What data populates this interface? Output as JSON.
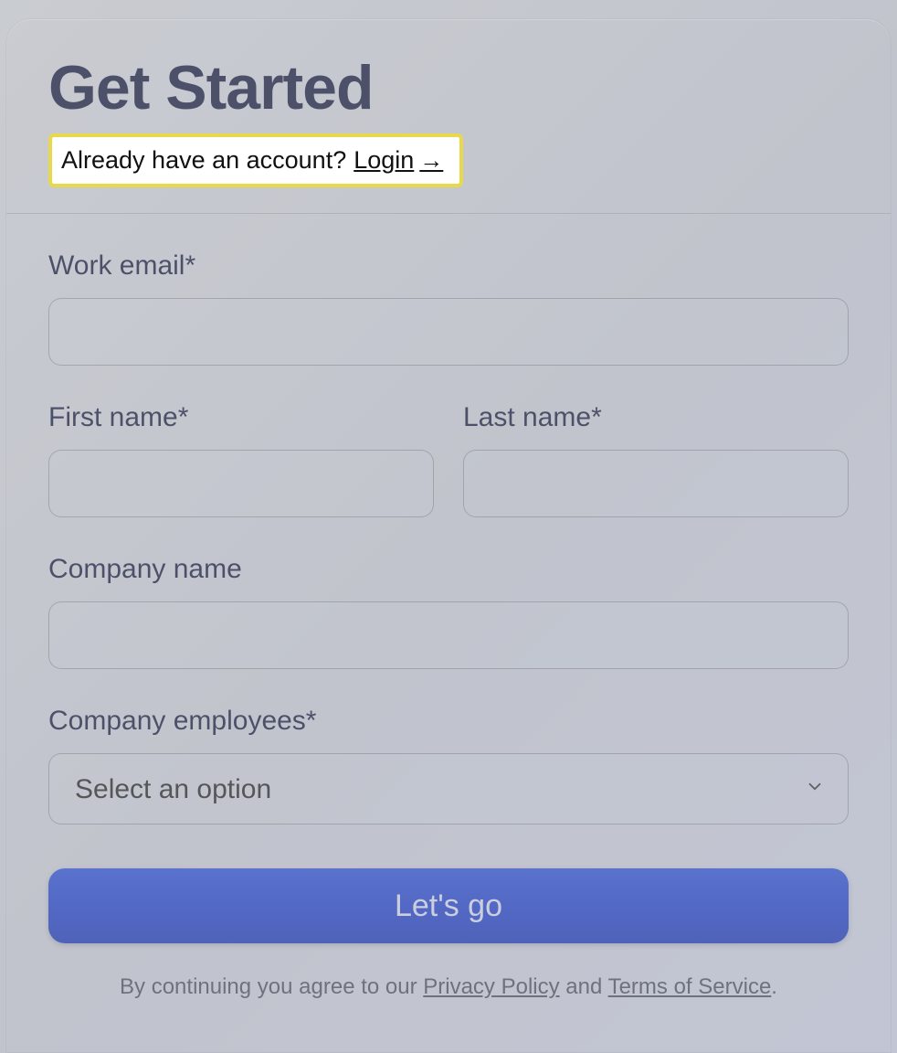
{
  "header": {
    "title": "Get Started",
    "already_text": "Already have an account?",
    "login_label": "Login"
  },
  "form": {
    "work_email": {
      "label": "Work email*",
      "value": ""
    },
    "first_name": {
      "label": "First name*",
      "value": ""
    },
    "last_name": {
      "label": "Last name*",
      "value": ""
    },
    "company_name": {
      "label": "Company name",
      "value": ""
    },
    "company_employees": {
      "label": "Company employees*",
      "placeholder": "Select an option",
      "value": ""
    },
    "submit_label": "Let's go"
  },
  "footer": {
    "prefix": "By continuing you agree to our ",
    "privacy": "Privacy Policy",
    "and": " and ",
    "tos": "Terms of Service",
    "suffix": "."
  }
}
